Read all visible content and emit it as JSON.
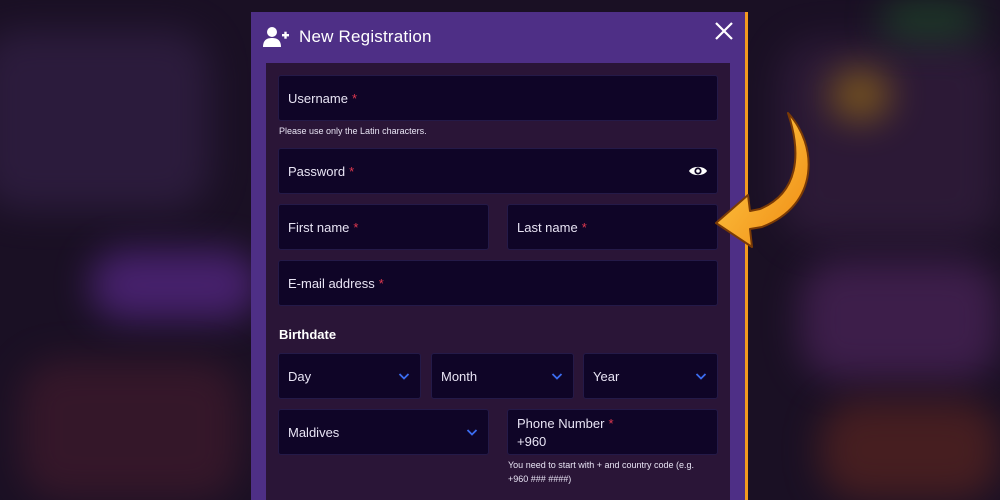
{
  "modal": {
    "title": "New Registration",
    "close_icon": "close-icon",
    "header_icon": "user-plus-icon"
  },
  "form": {
    "username": {
      "label": "Username",
      "required": "*",
      "hint": "Please use only the Latin characters."
    },
    "password": {
      "label": "Password",
      "required": "*",
      "icon": "eye-icon"
    },
    "first_name": {
      "label": "First name",
      "required": "*"
    },
    "last_name": {
      "label": "Last name",
      "required": "*"
    },
    "email": {
      "label": "E-mail address",
      "required": "*"
    },
    "birthdate": {
      "label": "Birthdate",
      "day": "Day",
      "month": "Month",
      "year": "Year"
    },
    "country": {
      "value": "Maldives"
    },
    "phone": {
      "label": "Phone Number",
      "required": "*",
      "value": "+960",
      "hint_line1": "You need to start with + and country code (e.g.",
      "hint_line2": "+960 ### ####)"
    }
  },
  "colors": {
    "modal_bg": "#4e2f86",
    "form_bg": "#2a1537",
    "field_bg": "#0f0527",
    "required": "#e0394f",
    "accent_arrow": "#f39a1e",
    "chevron": "#3b6cf0"
  }
}
